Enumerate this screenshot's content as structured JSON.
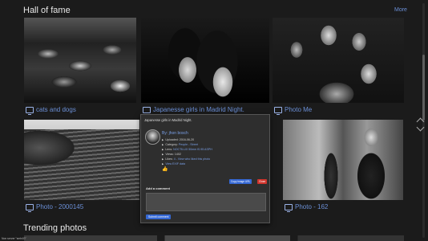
{
  "hall": {
    "title": "Hall of fame",
    "more": "More",
    "tiles": [
      {
        "caption": "cats and dogs"
      },
      {
        "caption": "Japanesse girls in Madrid Night."
      },
      {
        "caption": "Photo Me"
      },
      {
        "caption": "Photo - 2000145"
      },
      {
        "caption": "Photo - 162"
      }
    ]
  },
  "trending": {
    "title": "Trending photos"
  },
  "modal": {
    "title": "Japanesse girls in Madrid Night.",
    "by_label": "By:",
    "author": "jhon bosch",
    "uploaded_label": "Uploaded:",
    "uploaded": "2016-06-20",
    "category_label": "Category:",
    "category": "People - Street",
    "lens_label": "Lens:",
    "lens": "NOCTILUX 50mm f0.95 ASPH",
    "views_label": "Views:",
    "views": "1402",
    "likes_label": "Likes:",
    "likes": "4 - View who liked this photo",
    "exif": "View EXIF data",
    "copy_url": "Copy image URL",
    "close": "Close",
    "add_comment": "Add a comment",
    "comment_placeholder": "",
    "submit": "Submit comment"
  },
  "status_bar": {
    "text": "Non server \"smb4G\""
  },
  "colors": {
    "link": "#6b8fd6",
    "button_blue": "#3568d4",
    "button_red": "#d0342c"
  }
}
